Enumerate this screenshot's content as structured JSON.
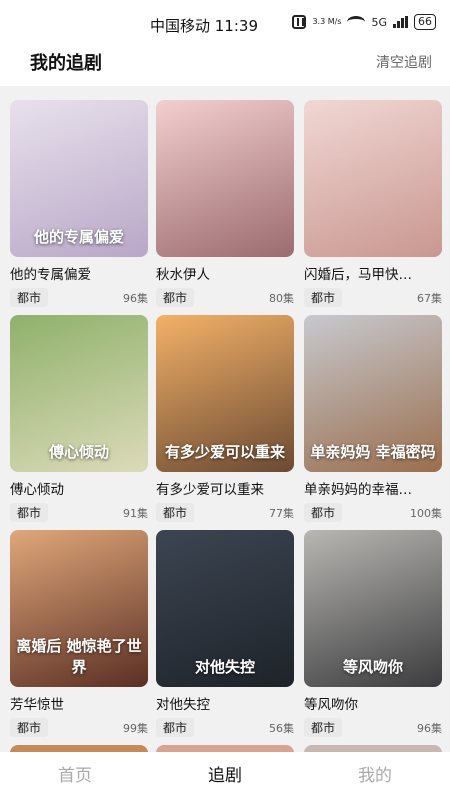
{
  "status_bar": {
    "carrier_time": "中国移动 11:39",
    "speed": "3.3 M/s",
    "network": "5G",
    "battery": "66"
  },
  "header": {
    "title": "我的追剧",
    "clear_label": "清空追剧"
  },
  "dramas": [
    {
      "title": "他的专属偏爱",
      "genre": "都市",
      "episodes": "96集",
      "poster_text": "他的专属偏爱",
      "colors": [
        "#e8e1ec",
        "#b8a7c7"
      ]
    },
    {
      "title": "秋水伊人",
      "genre": "都市",
      "episodes": "80集",
      "poster_text": "",
      "colors": [
        "#f3cfd0",
        "#9b6b6f"
      ]
    },
    {
      "title": "闪婚后，马甲快…",
      "genre": "都市",
      "episodes": "67集",
      "poster_text": "",
      "colors": [
        "#f1d7d4",
        "#c99790"
      ]
    },
    {
      "title": "傅心倾动",
      "genre": "都市",
      "episodes": "91集",
      "poster_text": "傅心倾动",
      "colors": [
        "#8fb16b",
        "#dcdab9"
      ]
    },
    {
      "title": "有多少爱可以重来",
      "genre": "都市",
      "episodes": "77集",
      "poster_text": "有多少爱可以重来",
      "colors": [
        "#f3b168",
        "#6b4a33"
      ]
    },
    {
      "title": "单亲妈妈的幸福…",
      "genre": "都市",
      "episodes": "100集",
      "poster_text": "单亲妈妈 幸福密码",
      "colors": [
        "#c7c9cf",
        "#9a6e4d"
      ]
    },
    {
      "title": "芳华惊世",
      "genre": "都市",
      "episodes": "99集",
      "poster_text": "离婚后 她惊艳了世界",
      "colors": [
        "#e0a77a",
        "#5a2f24"
      ]
    },
    {
      "title": "对他失控",
      "genre": "都市",
      "episodes": "56集",
      "poster_text": "对他失控",
      "colors": [
        "#3c4552",
        "#1e2329"
      ]
    },
    {
      "title": "等风吻你",
      "genre": "都市",
      "episodes": "96集",
      "poster_text": "等风吻你",
      "colors": [
        "#b8b7b3",
        "#3c3c3e"
      ]
    }
  ],
  "bottom_nav": {
    "home": "首页",
    "dramas": "追剧",
    "mine": "我的"
  }
}
